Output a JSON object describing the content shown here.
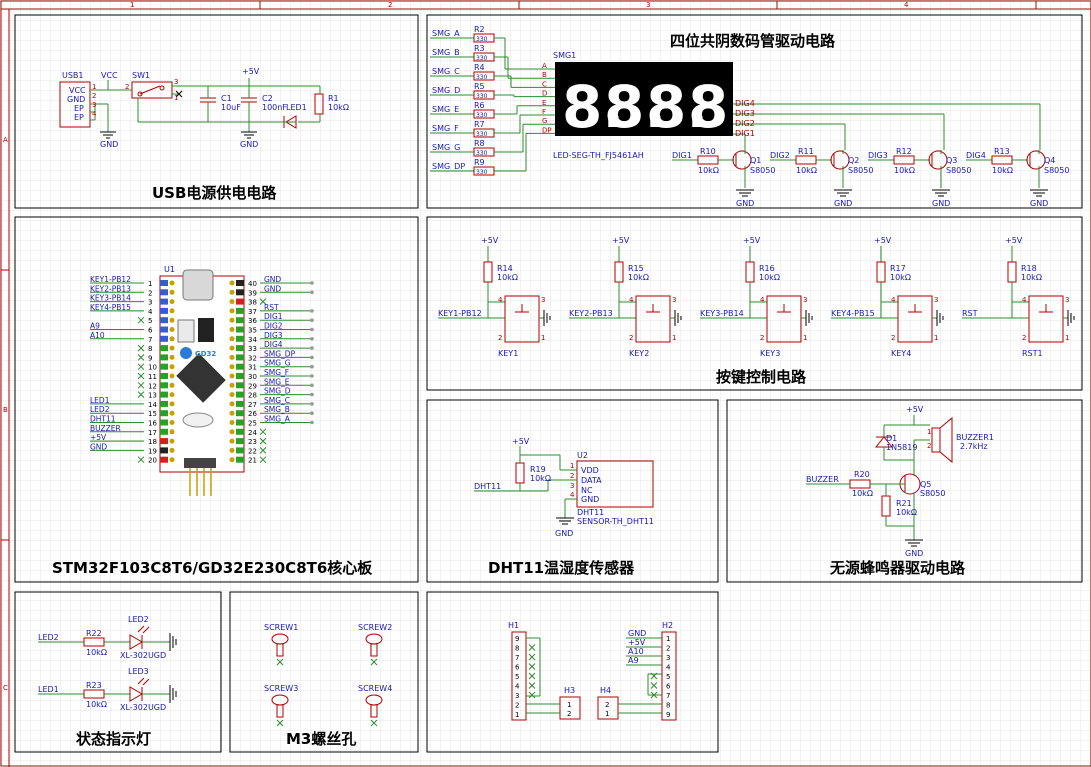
{
  "frame": {
    "col_marks": [
      "1",
      "2",
      "3",
      "4"
    ],
    "row_marks": [
      "A",
      "B",
      "C"
    ]
  },
  "panels": {
    "usb_power": {
      "title": "USB电源供电电路"
    },
    "seg_display": {
      "title": "四位共阴数码管驱动电路"
    },
    "mcu": {
      "title": "STM32F103C8T6/GD32E230C8T6核心板"
    },
    "keys": {
      "title": "按键控制电路"
    },
    "dht11": {
      "title": "DHT11温湿度传感器"
    },
    "buzzer": {
      "title": "无源蜂鸣器驱动电路"
    },
    "status_leds": {
      "title": "状态指示灯"
    },
    "screw_holes": {
      "title": "M3螺丝孔"
    },
    "headers": {
      "title": ""
    }
  },
  "usb_power": {
    "usb_ref": "USB1",
    "usb_pins": [
      "VCC",
      "GND",
      "EP",
      "EP"
    ],
    "usb_pin_nums": [
      "1",
      "2",
      "3",
      "4"
    ],
    "vcc": "VCC",
    "sw_ref": "SW1",
    "sw_pins": [
      "2",
      "3",
      "1"
    ],
    "plus5v": "+5V",
    "c1_ref": "C1",
    "c1_val": "10uF",
    "c2_ref": "C2",
    "c2_val": "100nF",
    "led_ref": "LED1",
    "r1_ref": "R1",
    "r1_val": "10kΩ",
    "gnd": "GND"
  },
  "seg_display": {
    "inputs": [
      {
        "net": "SMG_A",
        "ref": "R2",
        "val": "330",
        "pin": "A"
      },
      {
        "net": "SMG_B",
        "ref": "R3",
        "val": "330",
        "pin": "B"
      },
      {
        "net": "SMG_C",
        "ref": "R4",
        "val": "330",
        "pin": "C"
      },
      {
        "net": "SMG_D",
        "ref": "R5",
        "val": "330",
        "pin": "D"
      },
      {
        "net": "SMG_E",
        "ref": "R6",
        "val": "330",
        "pin": "E"
      },
      {
        "net": "SMG_F",
        "ref": "R7",
        "val": "330",
        "pin": "F"
      },
      {
        "net": "SMG_G",
        "ref": "R8",
        "val": "330",
        "pin": "G"
      },
      {
        "net": "SMG_DP",
        "ref": "R9",
        "val": "330",
        "pin": "DP"
      }
    ],
    "smg_ref": "SMG1",
    "smg_part": "LED-SEG-TH_FJ5461AH",
    "digits": [
      "8.",
      "8.",
      "8.",
      "8."
    ],
    "dig_pins": [
      "DIG4",
      "DIG3",
      "DIG2",
      "DIG1"
    ],
    "drivers": [
      {
        "net": "DIG1",
        "r_ref": "R10",
        "r_val": "10kΩ",
        "q_ref": "Q1",
        "q_val": "S8050"
      },
      {
        "net": "DIG2",
        "r_ref": "R11",
        "r_val": "10kΩ",
        "q_ref": "Q2",
        "q_val": "S8050"
      },
      {
        "net": "DIG3",
        "r_ref": "R12",
        "r_val": "10kΩ",
        "q_ref": "Q3",
        "q_val": "S8050"
      },
      {
        "net": "DIG4",
        "r_ref": "R13",
        "r_val": "10kΩ",
        "q_ref": "Q4",
        "q_val": "S8050"
      }
    ],
    "gnd": "GND"
  },
  "mcu": {
    "ref": "U1",
    "left_nets": [
      "KEY1-PB12",
      "KEY2-PB13",
      "KEY3-PB14",
      "KEY4-PB15",
      "",
      "A9",
      "A10",
      "",
      "",
      "",
      "",
      "",
      "",
      "LED1",
      "LED2",
      "DHT11",
      "BUZZER",
      "+5V",
      "GND",
      ""
    ],
    "left_nums": [
      "1",
      "2",
      "3",
      "4",
      "5",
      "6",
      "7",
      "8",
      "9",
      "10",
      "11",
      "12",
      "13",
      "14",
      "15",
      "16",
      "17",
      "18",
      "19",
      "20"
    ],
    "right_nets": [
      "GND",
      "GND",
      "",
      "RST",
      "DIG1",
      "DIG2",
      "DIG3",
      "DIG4",
      "SMG_DP",
      "SMG_G",
      "SMG_F",
      "SMG_E",
      "SMG_D",
      "SMG_C",
      "SMG_B",
      "SMG_A",
      "",
      "",
      "",
      ""
    ],
    "right_nums": [
      "40",
      "39",
      "38",
      "37",
      "36",
      "35",
      "34",
      "33",
      "32",
      "31",
      "30",
      "29",
      "28",
      "27",
      "26",
      "25",
      "24",
      "23",
      "22",
      "21"
    ],
    "logo": "GD32"
  },
  "keys": {
    "plus5v": "+5V",
    "items": [
      {
        "r_ref": "R14",
        "r_val": "10kΩ",
        "net": "KEY1-PB12",
        "key_ref": "KEY1"
      },
      {
        "r_ref": "R15",
        "r_val": "10kΩ",
        "net": "KEY2-PB13",
        "key_ref": "KEY2"
      },
      {
        "r_ref": "R16",
        "r_val": "10kΩ",
        "net": "KEY3-PB14",
        "key_ref": "KEY3"
      },
      {
        "r_ref": "R17",
        "r_val": "10kΩ",
        "net": "KEY4-PB15",
        "key_ref": "KEY4"
      },
      {
        "r_ref": "R18",
        "r_val": "10kΩ",
        "net": "RST",
        "key_ref": "RST1"
      }
    ]
  },
  "dht11": {
    "plus5v": "+5V",
    "r_ref": "R19",
    "r_val": "10kΩ",
    "net": "DHT11",
    "u_ref": "U2",
    "pins": [
      "VDD",
      "DATA",
      "NC",
      "GND"
    ],
    "pin_nums": [
      "1",
      "2",
      "3",
      "4"
    ],
    "part_name": "DHT11",
    "part": "SENSOR-TH_DHT11",
    "gnd": "GND"
  },
  "buzzer": {
    "plus5v": "+5V",
    "d_ref": "D1",
    "d_val": "1N5819",
    "bz_ref": "BUZZER1",
    "bz_val": "2.7kHz",
    "net": "BUZZER",
    "r20_ref": "R20",
    "r20_val": "10kΩ",
    "r21_ref": "R21",
    "r21_val": "10kΩ",
    "q_ref": "Q5",
    "q_val": "S8050",
    "gnd": "GND"
  },
  "status_leds": {
    "items": [
      {
        "net": "LED2",
        "r_ref": "R22",
        "r_val": "10kΩ",
        "led_ref": "LED2",
        "led_val": "XL-302UGD"
      },
      {
        "net": "LED1",
        "r_ref": "R23",
        "r_val": "10kΩ",
        "led_ref": "LED3",
        "led_val": "XL-302UGD"
      }
    ]
  },
  "screw_holes": {
    "items": [
      "SCREW1",
      "SCREW2",
      "SCREW3",
      "SCREW4"
    ]
  },
  "headers": {
    "h1_ref": "H1",
    "h2_ref": "H2",
    "h3_ref": "H3",
    "h4_ref": "H4",
    "h1_pins": [
      "9",
      "8",
      "7",
      "6",
      "5",
      "4",
      "3",
      "2",
      "1"
    ],
    "h2_pins": [
      "1",
      "2",
      "3",
      "4",
      "5",
      "6",
      "7",
      "8",
      "9"
    ],
    "h2_nets": [
      "GND",
      "+5V",
      "A10",
      "A9"
    ],
    "h3_pins": [
      "1",
      "2"
    ],
    "h4_pins": [
      "2",
      "1"
    ]
  },
  "colors": {
    "wire": "#2e8b2e",
    "component": "#b00000",
    "net_label": "#1a1ab0",
    "title": "#000000",
    "grid": "#e4e4e4",
    "frame": "#b00000"
  }
}
